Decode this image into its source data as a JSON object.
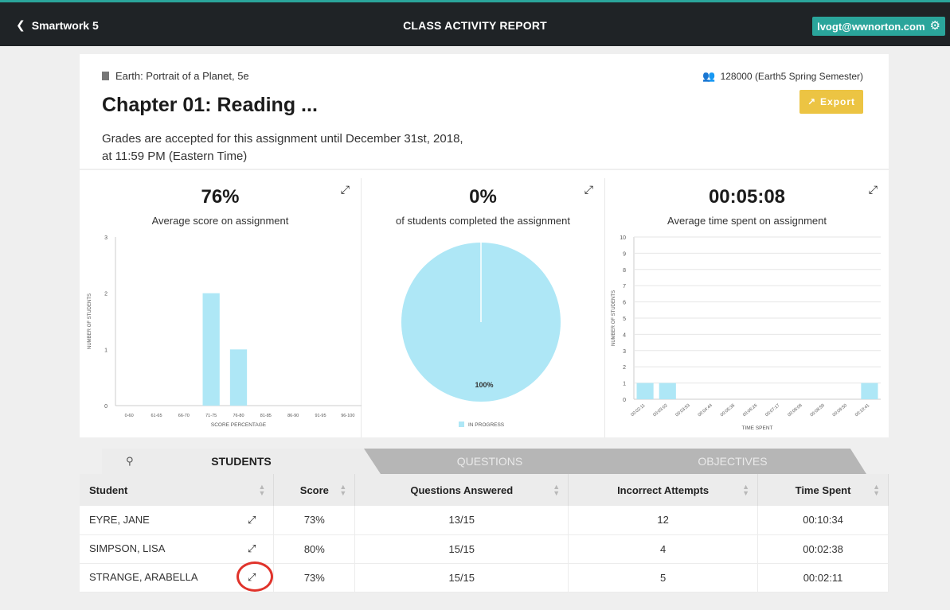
{
  "topbar": {
    "back_label": "Smartwork 5",
    "title": "CLASS ACTIVITY REPORT",
    "user_email": "lvogt@wwnorton.com"
  },
  "header": {
    "book": "Earth: Portrait of a Planet, 5e",
    "chapter": "Chapter 01: Reading ...",
    "grades_note": "Grades are accepted for this assignment until December 31st, 2018, at 11:59 PM (Eastern Time)",
    "class_info": "128000 (Earth5 Spring Semester)",
    "export_label": "Export"
  },
  "stats": {
    "score": {
      "value": "76%",
      "caption": "Average score on assignment"
    },
    "completion": {
      "value": "0%",
      "caption": "of students completed the assignment"
    },
    "time": {
      "value": "00:05:08",
      "caption": "Average time spent on assignment"
    }
  },
  "chart_data": [
    {
      "type": "bar",
      "title": "Average score on assignment",
      "xlabel": "SCORE PERCENTAGE",
      "ylabel": "NUMBER OF STUDENTS",
      "categories": [
        "0-60",
        "61-65",
        "66-70",
        "71-75",
        "76-80",
        "81-85",
        "86-90",
        "91-95",
        "96-100"
      ],
      "values": [
        0,
        0,
        0,
        2,
        1,
        0,
        0,
        0,
        0
      ],
      "ylim": [
        0,
        3
      ],
      "yticks": [
        0,
        1,
        2,
        3
      ],
      "color": "#aee7f6"
    },
    {
      "type": "pie",
      "title": "of students completed the assignment",
      "slices": [
        {
          "label": "IN PROGRESS",
          "value": 100
        }
      ],
      "data_label": "100%",
      "legend": "bottom",
      "color": "#aee7f6"
    },
    {
      "type": "bar",
      "title": "Average time spent on assignment",
      "xlabel": "TIME SPENT",
      "ylabel": "NUMBER OF STUDENTS",
      "categories": [
        "00:02:11",
        "00:03:02",
        "00:03:53",
        "00:04:44",
        "00:05:35",
        "00:06:26",
        "00:07:17",
        "00:08:08",
        "00:08:59",
        "00:09:50",
        "00:10:41"
      ],
      "values": [
        1,
        1,
        0,
        0,
        0,
        0,
        0,
        0,
        0,
        0,
        1
      ],
      "ylim": [
        0,
        10
      ],
      "yticks": [
        0,
        1,
        2,
        3,
        4,
        5,
        6,
        7,
        8,
        9,
        10
      ],
      "color": "#aee7f6"
    }
  ],
  "tabs": [
    {
      "label": "STUDENTS",
      "active": true
    },
    {
      "label": "QUESTIONS",
      "active": false
    },
    {
      "label": "OBJECTIVES",
      "active": false
    }
  ],
  "table": {
    "headers": [
      "Student",
      "Score",
      "Questions Answered",
      "Incorrect Attempts",
      "Time Spent"
    ],
    "rows": [
      {
        "student": "EYRE, JANE",
        "score": "73%",
        "answered": "13/15",
        "incorrect": "12",
        "time": "00:10:34"
      },
      {
        "student": "SIMPSON, LISA",
        "score": "80%",
        "answered": "15/15",
        "incorrect": "4",
        "time": "00:02:38"
      },
      {
        "student": "STRANGE, ARABELLA",
        "score": "73%",
        "answered": "15/15",
        "incorrect": "5",
        "time": "00:02:11"
      }
    ]
  }
}
